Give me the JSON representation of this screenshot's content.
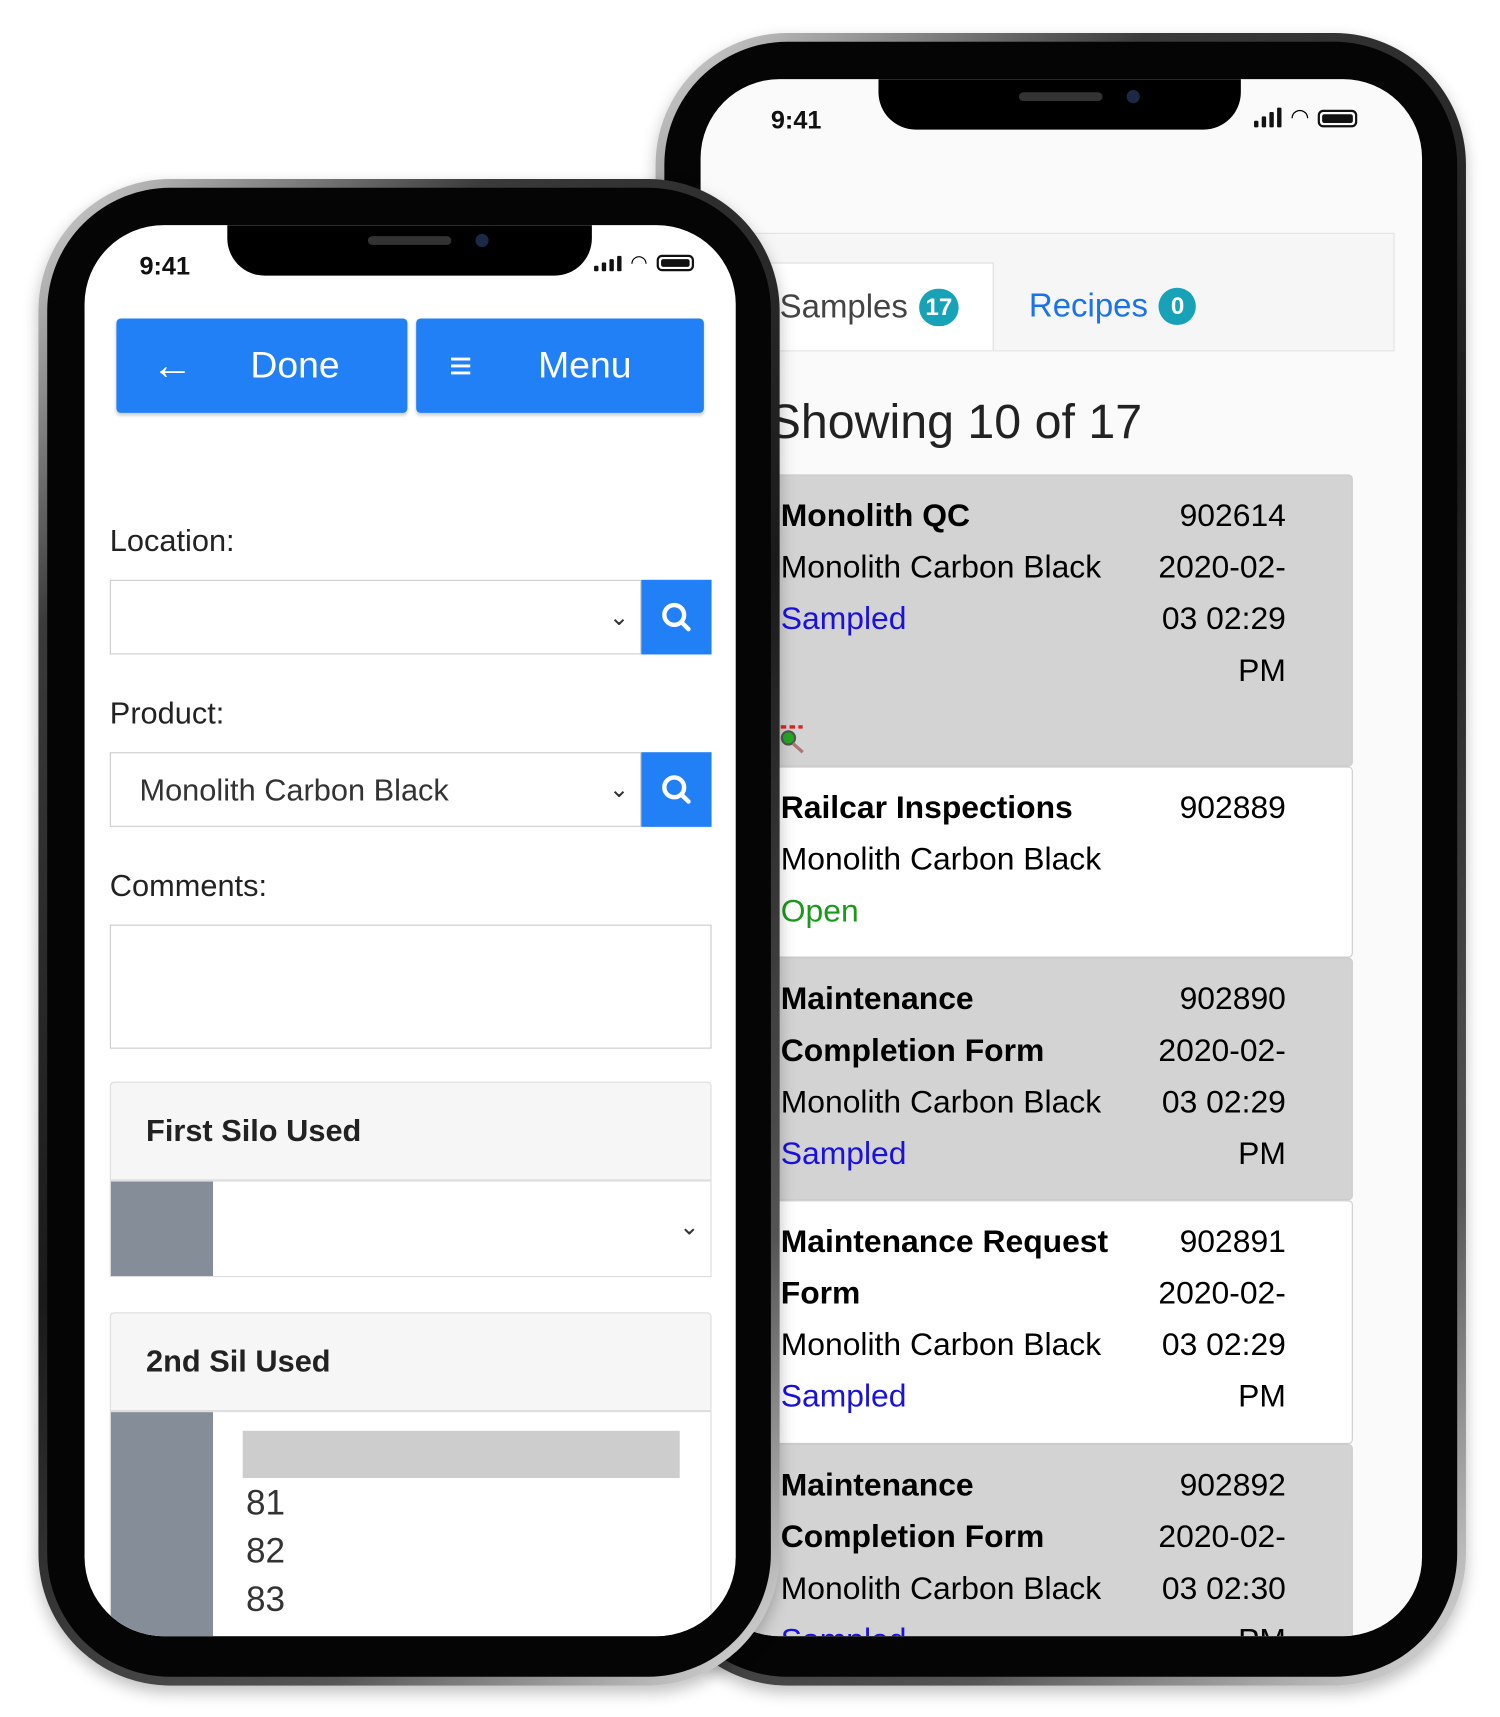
{
  "status_bar": {
    "time": "9:41"
  },
  "back_phone": {
    "tabs": [
      {
        "label": "Samples",
        "count": "17",
        "active": true
      },
      {
        "label": "Recipes",
        "count": "0",
        "active": false
      }
    ],
    "heading": "Showing 10 of 17",
    "samples": [
      {
        "title_lines": [
          "Monolith QC"
        ],
        "product": "Monolith Carbon Black",
        "status": "Sampled",
        "id": "902614",
        "date_lines": [
          "2020-02-",
          "03 02:29",
          "PM"
        ],
        "has_icon": true,
        "icon": "magnifier-settings-icon"
      },
      {
        "title_lines": [
          "Railcar Inspections"
        ],
        "product": "Monolith Carbon Black",
        "status": "Open",
        "id": "902889",
        "date_lines": []
      },
      {
        "title_lines": [
          "Maintenance",
          "Completion Form"
        ],
        "product": "Monolith Carbon Black",
        "status": "Sampled",
        "id": "902890",
        "date_lines": [
          "2020-02-",
          "03 02:29",
          "PM"
        ]
      },
      {
        "title_lines": [
          "Maintenance Request",
          "Form"
        ],
        "product": "Monolith Carbon Black",
        "status": "Sampled",
        "id": "902891",
        "date_lines": [
          "2020-02-",
          "03 02:29",
          "PM"
        ]
      },
      {
        "title_lines": [
          "Maintenance",
          "Completion Form"
        ],
        "product": "Monolith Carbon Black",
        "status": "Sampled",
        "id": "902892",
        "date_lines": [
          "2020-02-",
          "03 02:30",
          "PM"
        ]
      }
    ],
    "colors": {
      "sampled": "#1a10e0",
      "open": "#1a9a1a",
      "badge": "#17a2b8",
      "card_alt": "#d3d3d3"
    }
  },
  "front_phone": {
    "done_label": "Done",
    "menu_label": "Menu",
    "location_label": "Location:",
    "location_value": "",
    "product_label": "Product:",
    "product_value": "Monolith Carbon Black",
    "comments_label": "Comments:",
    "comments_value": "",
    "first_silo": {
      "title": "First Silo Used",
      "value": ""
    },
    "second_silo": {
      "title": "2nd Sil Used",
      "options": [
        "",
        "81",
        "82",
        "83"
      ]
    },
    "colors": {
      "primary": "#2280f7",
      "addon": "#858e98"
    }
  }
}
